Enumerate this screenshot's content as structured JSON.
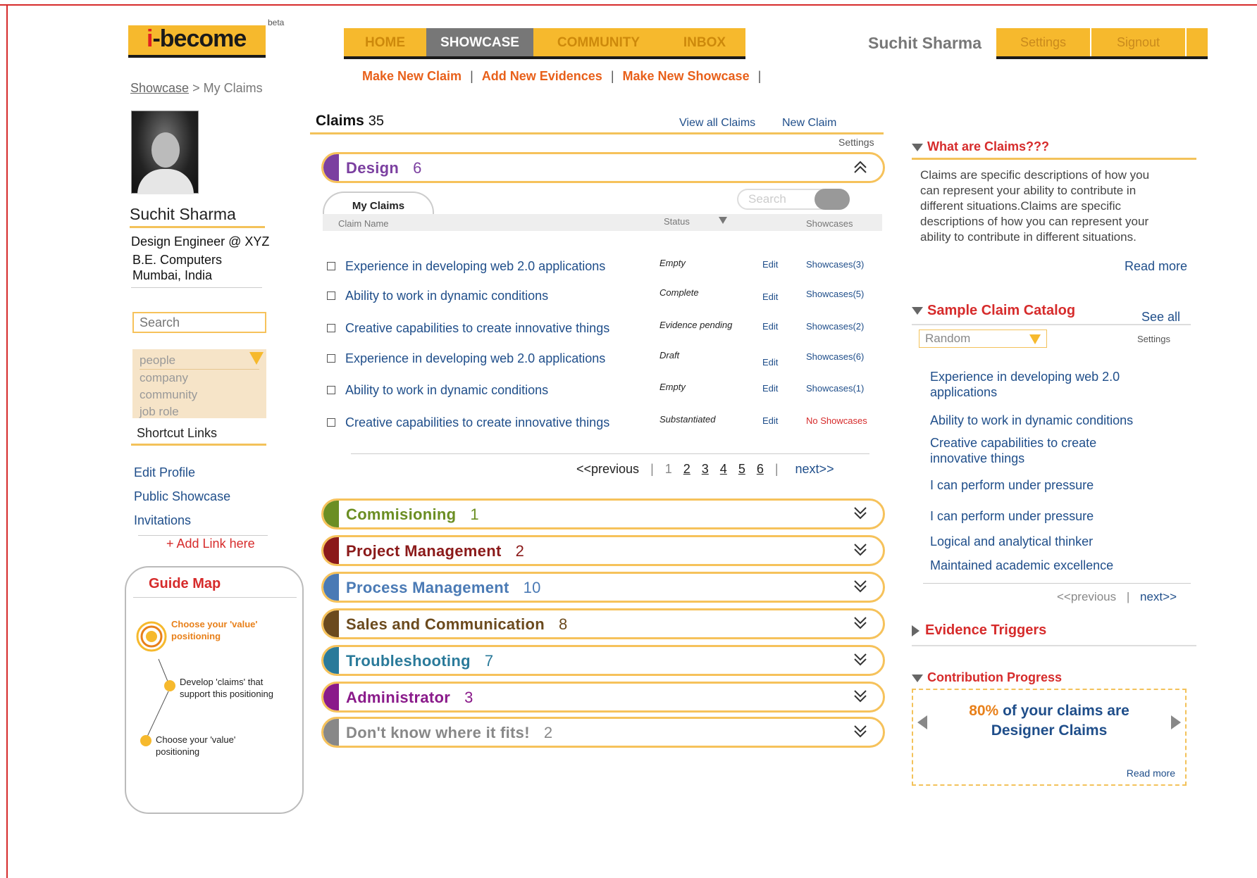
{
  "app": {
    "logo": "i-become",
    "logo_i": "i",
    "logo_rest": "-become",
    "beta": "beta"
  },
  "nav": {
    "items": [
      "HOME",
      "SHOWCASE",
      "COMMUNITY",
      "INBOX"
    ],
    "active": "SHOWCASE"
  },
  "user": {
    "name": "Suchit Sharma",
    "settings": "Settings",
    "signout": "Signout"
  },
  "sublinks": [
    "Make New Claim",
    "Add New Evidences",
    "Make New Showcase"
  ],
  "breadcrumb": {
    "parent": "Showcase",
    "sep": " > ",
    "current": "My Claims"
  },
  "profile": {
    "name": "Suchit Sharma",
    "title": "Design Engineer @ XYZ",
    "education": "B.E. Computers",
    "location": "Mumbai, India"
  },
  "left_search": {
    "placeholder": "Search"
  },
  "left_filter": {
    "options": [
      "people",
      "company",
      "community",
      "job role"
    ]
  },
  "shortcuts": {
    "title": "Shortcut Links",
    "links": [
      "Edit Profile",
      "Public Showcase",
      "Invitations"
    ],
    "add": "+ Add Link here"
  },
  "guide": {
    "title": "Guide Map",
    "step1": "Choose your 'value' positioning",
    "step2": "Develop 'claims' that support this positioning",
    "step3": "Choose your 'value' positioning"
  },
  "claims": {
    "title": "Claims",
    "count": "35",
    "view_all": "View all Claims",
    "new_claim": "New Claim",
    "settings": "Settings",
    "tab": "My Claims",
    "search_placeholder": "Search",
    "columns": {
      "name": "Claim Name",
      "status": "Status",
      "showcases": "Showcases"
    },
    "rows": [
      {
        "name": "Experience in developing web 2.0 applications",
        "status": "Empty",
        "edit": "Edit",
        "showcases": "Showcases(3)"
      },
      {
        "name": "Ability to work in dynamic conditions",
        "status": "Complete",
        "edit": "Edit",
        "showcases": "Showcases(5)"
      },
      {
        "name": "Creative capabilities to create innovative things",
        "status": "Evidence pending",
        "edit": "Edit",
        "showcases": "Showcases(2)"
      },
      {
        "name": "Experience in developing web 2.0 applications",
        "status": "Draft",
        "edit": "Edit",
        "showcases": "Showcases(6)"
      },
      {
        "name": "Ability to work in dynamic conditions",
        "status": "Empty",
        "edit": "Edit",
        "showcases": "Showcases(1)"
      },
      {
        "name": "Creative capabilities to create innovative things",
        "status": "Substantiated",
        "edit": "Edit",
        "showcases": "No Showcases"
      }
    ],
    "pager": {
      "prev": "<<previous",
      "pages": [
        "1",
        "2",
        "3",
        "4",
        "5",
        "6"
      ],
      "next": "next>>"
    }
  },
  "categories": [
    {
      "name": "Design",
      "count": "6",
      "color": "#7b3fa0",
      "text": "#7b3fa0"
    },
    {
      "name": "Commisioning",
      "count": "1",
      "color": "#6b8e23",
      "text": "#6b8e23"
    },
    {
      "name": "Project Management",
      "count": "2",
      "color": "#8b1a1a",
      "text": "#8b1a1a"
    },
    {
      "name": "Process Management",
      "count": "10",
      "color": "#4a7ab5",
      "text": "#4a7ab5"
    },
    {
      "name": "Sales and Communication",
      "count": "8",
      "color": "#6b4a1e",
      "text": "#6b4a1e"
    },
    {
      "name": "Troubleshooting",
      "count": "7",
      "color": "#2a7a9a",
      "text": "#2a7a9a"
    },
    {
      "name": "Administrator",
      "count": "3",
      "color": "#8a1a8a",
      "text": "#8a1a8a"
    },
    {
      "name": "Don't know where it fits!",
      "count": "2",
      "color": "#888888",
      "text": "#888888"
    }
  ],
  "right": {
    "what_title": "What are Claims???",
    "what_text": "Claims are specific descriptions of how you can represent your ability to contribute in different situations.Claims are specific descriptions of how you can represent your ability to contribute in different situations.",
    "read_more": "Read more",
    "catalog_title": "Sample Claim Catalog",
    "see_all": "See all",
    "random": "Random",
    "settings": "Settings",
    "catalog": [
      "Experience in developing web 2.0 applications",
      "Ability to work in dynamic conditions",
      "Creative capabilities to create innovative things",
      "I can perform under pressure",
      "I can perform under pressure",
      "Logical and analytical thinker",
      "Maintained academic excellence"
    ],
    "catalog_prev": "<<previous",
    "catalog_next": "next>>",
    "evidence_title": "Evidence Triggers",
    "progress_title": "Contribution Progress",
    "progress_pct": "80%",
    "progress_text1": "of your claims are",
    "progress_text2": "Designer Claims",
    "progress_read": "Read more"
  },
  "colors": {
    "accent": "#f6b92d",
    "link": "#1f4e8a",
    "heading_red": "#d62b2b",
    "orange": "#e8601a"
  }
}
